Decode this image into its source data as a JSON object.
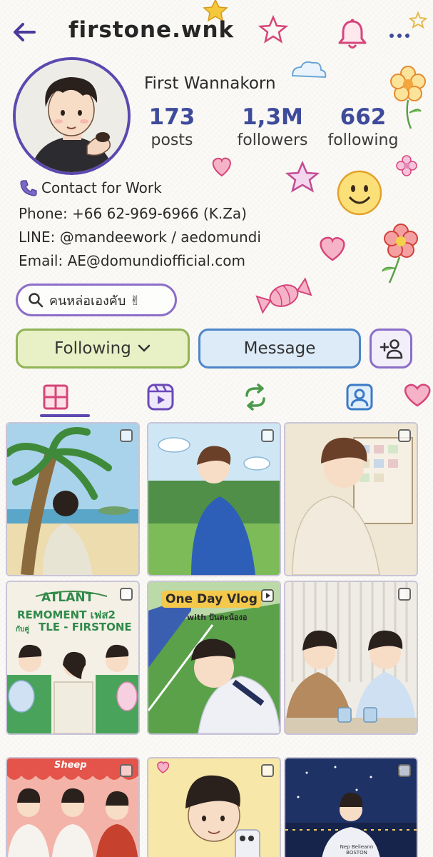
{
  "header": {
    "username": "firstone.wnk"
  },
  "profile": {
    "full_name": "First Wannakorn",
    "stats": [
      {
        "value": "173",
        "label": "posts"
      },
      {
        "value": "1,3M",
        "label": "followers"
      },
      {
        "value": "662",
        "label": "following"
      }
    ],
    "bio": {
      "contact_label": "Contact for Work",
      "phone": "Phone: +66 62-969-6966 (K.Za)",
      "line": "LINE: @mandeework / aedomundi",
      "email": "Email: AE@domundiofficial.com"
    },
    "highlight_search": "คนหล่อเองคับ ✌"
  },
  "actions": {
    "following_label": "Following",
    "message_label": "Message"
  },
  "tabs": [
    {
      "icon": "grid-icon"
    },
    {
      "icon": "reels-icon"
    },
    {
      "icon": "repost-icon"
    },
    {
      "icon": "tagged-icon"
    }
  ],
  "posts": {
    "tile4": {
      "line1": "ATLANT",
      "line2": "REMOMENT เฟส2",
      "line3a": "กับคู่",
      "line3b": "TLE - FIRSTONE"
    },
    "tile5": {
      "title": "One Day Vlog",
      "subtitle": "with ปันตะน้องอ"
    },
    "tile9": {
      "shirt": "Nep Belieann BOSTON"
    },
    "tile7": {
      "banner": "Sheep"
    }
  },
  "colors": {
    "accent": "#5c48b0",
    "stat_number": "#3e4b9b",
    "following_bg": "#e8f0c5",
    "message_bg": "#dcebf7"
  }
}
